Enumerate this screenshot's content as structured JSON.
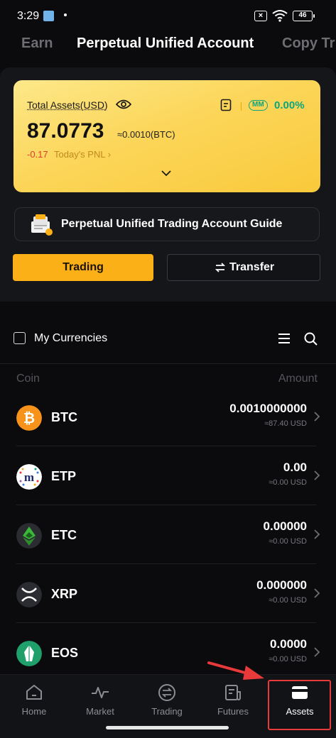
{
  "status": {
    "time": "3:29",
    "battery": "46"
  },
  "tabs": [
    {
      "label": "Earn"
    },
    {
      "label": "Perpetual Unified Account"
    },
    {
      "label": "Copy Tr"
    }
  ],
  "card": {
    "total_label": "Total Assets(USD)",
    "mm_label": "MM",
    "mm_pct": "0.00%",
    "total_value": "87.0773",
    "btc_equiv": "≈0.0010(BTC)",
    "pnl_value": "-0.17",
    "pnl_label": "Today's PNL ›"
  },
  "guide": {
    "label": "Perpetual Unified Trading Account Guide"
  },
  "buttons": {
    "trading": "Trading",
    "transfer": "Transfer"
  },
  "currencies": {
    "label": "My Currencies"
  },
  "columns": {
    "coin": "Coin",
    "amount": "Amount"
  },
  "coins": [
    {
      "symbol": "BTC",
      "amount": "0.0010000000",
      "usd": "≈87.40 USD",
      "icon": "btc-icon",
      "color": "#f7931a"
    },
    {
      "symbol": "ETP",
      "amount": "0.00",
      "usd": "≈0.00 USD",
      "icon": "etp-icon",
      "color": "#ffffff"
    },
    {
      "symbol": "ETC",
      "amount": "0.00000",
      "usd": "≈0.00 USD",
      "icon": "etc-icon",
      "color": "#328332"
    },
    {
      "symbol": "XRP",
      "amount": "0.000000",
      "usd": "≈0.00 USD",
      "icon": "xrp-icon",
      "color": "#23292f"
    },
    {
      "symbol": "EOS",
      "amount": "0.0000",
      "usd": "≈0.00 USD",
      "icon": "eos-icon",
      "color": "#1f9f6a"
    }
  ],
  "nav": [
    {
      "label": "Home",
      "icon": "home-icon"
    },
    {
      "label": "Market",
      "icon": "market-icon"
    },
    {
      "label": "Trading",
      "icon": "trading-icon"
    },
    {
      "label": "Futures",
      "icon": "futures-icon"
    },
    {
      "label": "Assets",
      "icon": "wallet-icon",
      "active": true
    }
  ],
  "colors": {
    "accent": "#fcb017",
    "positive": "#0aa57d",
    "negative": "#e23c2d",
    "annotation": "#e83a3a"
  }
}
